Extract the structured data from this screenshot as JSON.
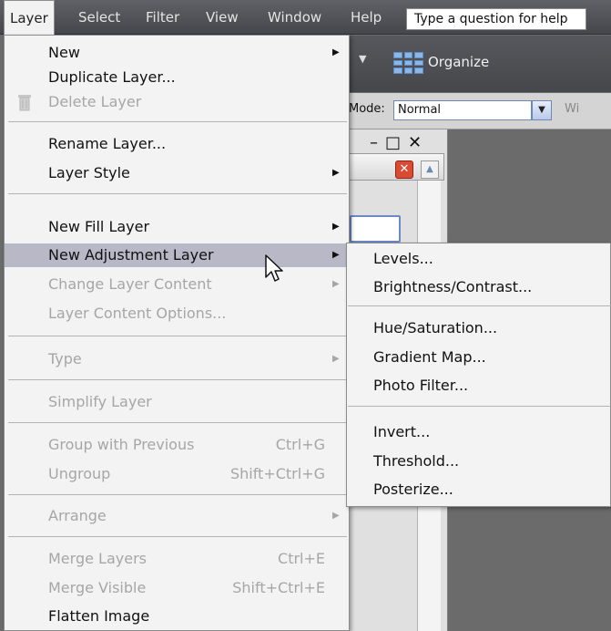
{
  "menubar": {
    "items": [
      "Layer",
      "Select",
      "Filter",
      "View",
      "Window",
      "Help"
    ],
    "help_placeholder": "Type a question for help"
  },
  "toolbar": {
    "organize_label": "Organize"
  },
  "options_bar": {
    "mode_label": "Mode:",
    "mode_value": "Normal",
    "wi_label": "Wi"
  },
  "layer_menu": {
    "new": "New",
    "duplicate": "Duplicate Layer...",
    "delete": "Delete Layer",
    "rename": "Rename Layer...",
    "layer_style": "Layer Style",
    "new_fill": "New Fill Layer",
    "new_adjustment": "New Adjustment Layer",
    "change_content": "Change Layer Content",
    "content_options": "Layer Content Options...",
    "type": "Type",
    "simplify": "Simplify Layer",
    "group_prev": "Group with Previous",
    "group_prev_sc": "Ctrl+G",
    "ungroup": "Ungroup",
    "ungroup_sc": "Shift+Ctrl+G",
    "arrange": "Arrange",
    "merge_layers": "Merge Layers",
    "merge_layers_sc": "Ctrl+E",
    "merge_visible": "Merge Visible",
    "merge_visible_sc": "Shift+Ctrl+E",
    "flatten": "Flatten Image"
  },
  "adjustment_submenu": {
    "levels": "Levels...",
    "brightness": "Brightness/Contrast...",
    "hue": "Hue/Saturation...",
    "gradient_map": "Gradient Map...",
    "photo_filter": "Photo Filter...",
    "invert": "Invert...",
    "threshold": "Threshold...",
    "posterize": "Posterize..."
  },
  "colors": {
    "highlight": "#b8b8c7",
    "menu_bg": "#f3f3f3",
    "disabled_text": "#a6a6a6"
  }
}
